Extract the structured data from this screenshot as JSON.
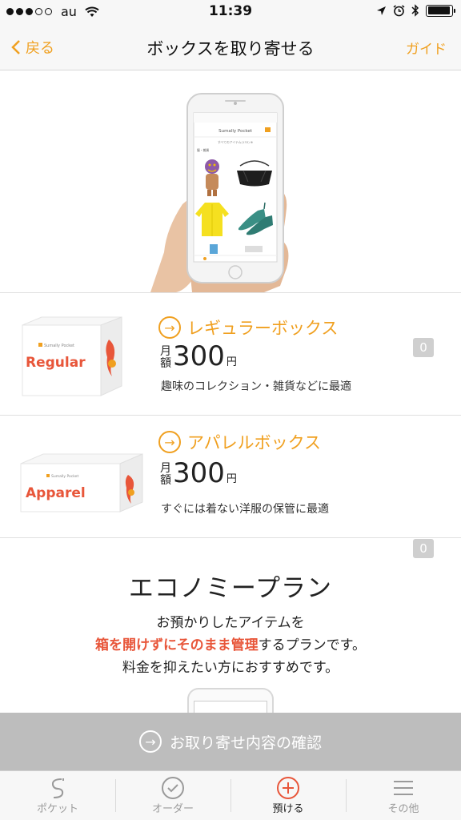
{
  "status_bar": {
    "carrier": "au",
    "time": "11:39",
    "battery_level": 0.95
  },
  "nav": {
    "back_label": "戻る",
    "title": "ボックスを取り寄せる",
    "guide_label": "ガイド"
  },
  "hero": {
    "phone_app_title": "Sumally Pocket",
    "phone_filter": "すべてのアイテム(133) ⊕",
    "phone_section": "服・雑貨"
  },
  "boxes": [
    {
      "name": "レギュラーボックス",
      "box_label": "Regular",
      "box_brand": "Sumally Pocket",
      "price_prefix_top": "月",
      "price_prefix_bottom": "額",
      "price": "300",
      "currency": "円",
      "description": "趣味のコレクション・雑貨などに最適",
      "quantity": "0"
    },
    {
      "name": "アパレルボックス",
      "box_label": "Apparel",
      "box_brand": "Sumally Pocket",
      "price_prefix_top": "月",
      "price_prefix_bottom": "額",
      "price": "300",
      "currency": "円",
      "description": "すぐには着ない洋服の保管に最適",
      "quantity": "0"
    }
  ],
  "economy": {
    "title": "エコノミープラン",
    "line1": "お預かりしたアイテムを",
    "line2_emphasis": "箱を開けずにそのまま管理",
    "line2_rest": "するプランです。",
    "line3": "料金を抑えたい方におすすめです。"
  },
  "confirm": {
    "label": "お取り寄せ内容の確認"
  },
  "tabs": [
    {
      "label": "ポケット",
      "icon": "pocket-icon"
    },
    {
      "label": "オーダー",
      "icon": "check-circle-icon"
    },
    {
      "label": "預ける",
      "icon": "plus-circle-icon"
    },
    {
      "label": "その他",
      "icon": "menu-icon"
    }
  ],
  "colors": {
    "accent": "#f0a020",
    "brand_red": "#e8563a",
    "disabled": "#bdbdbd"
  }
}
